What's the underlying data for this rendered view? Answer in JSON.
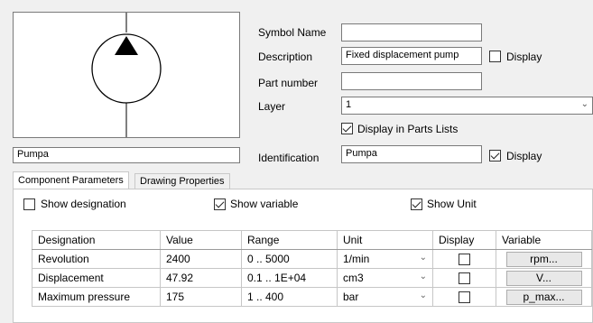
{
  "symbol": {
    "name": "Pumpa",
    "icon": "hydraulic-pump-symbol-icon"
  },
  "props": {
    "symbol_name_label": "Symbol Name",
    "symbol_name_value": "",
    "description_label": "Description",
    "description_value": "Fixed displacement pump",
    "description_display": "Display",
    "part_number_label": "Part number",
    "part_number_value": "",
    "layer_label": "Layer",
    "layer_value": "1",
    "display_in_parts_lists": "Display in Parts Lists",
    "identification_label": "Identification",
    "identification_value": "Pumpa",
    "identification_display": "Display"
  },
  "tabs": [
    {
      "label": "Component Parameters",
      "active": true
    },
    {
      "label": "Drawing Properties",
      "active": false
    }
  ],
  "options": {
    "show_designation": "Show designation",
    "show_variable": "Show variable",
    "show_unit": "Show Unit"
  },
  "table": {
    "headers": [
      "Designation",
      "Value",
      "Range",
      "Unit",
      "Display",
      "Variable"
    ],
    "rows": [
      {
        "designation": "Revolution",
        "value": "2400",
        "range": "0 .. 5000",
        "unit": "1/min",
        "variable": "rpm..."
      },
      {
        "designation": "Displacement",
        "value": "47.92",
        "range": "0.1 .. 1E+04",
        "unit": "cm3",
        "variable": "V..."
      },
      {
        "designation": "Maximum pressure",
        "value": "175",
        "range": "1 .. 400",
        "unit": "bar",
        "variable": "p_max..."
      }
    ]
  },
  "colors": {
    "window_bg": "#f0f0f0",
    "field_border": "#7a7a7a"
  }
}
